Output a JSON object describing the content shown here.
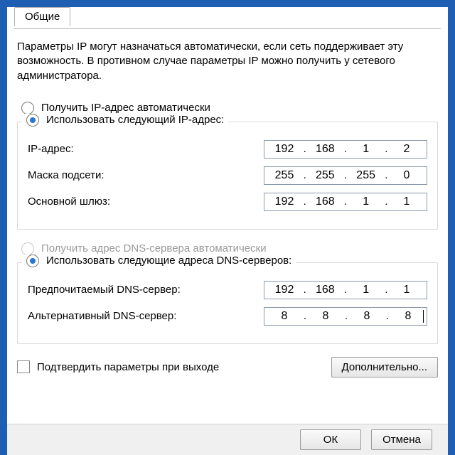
{
  "tab": {
    "label": "Общие"
  },
  "description": "Параметры IP могут назначаться автоматически, если сеть поддерживает эту возможность. В противном случае параметры IP можно получить у сетевого администратора.",
  "ip_section": {
    "auto_label": "Получить IP-адрес автоматически",
    "manual_label": "Использовать следующий IP-адрес:",
    "selected": "manual",
    "fields": {
      "ip": {
        "label": "IP-адрес:",
        "octets": [
          "192",
          "168",
          "1",
          "2"
        ]
      },
      "mask": {
        "label": "Маска подсети:",
        "octets": [
          "255",
          "255",
          "255",
          "0"
        ]
      },
      "gateway": {
        "label": "Основной шлюз:",
        "octets": [
          "192",
          "168",
          "1",
          "1"
        ]
      }
    }
  },
  "dns_section": {
    "auto_label": "Получить адрес DNS-сервера автоматически",
    "auto_enabled": false,
    "manual_label": "Использовать следующие адреса DNS-серверов:",
    "selected": "manual",
    "fields": {
      "preferred": {
        "label": "Предпочитаемый DNS-сервер:",
        "octets": [
          "192",
          "168",
          "1",
          "1"
        ]
      },
      "alternate": {
        "label": "Альтернативный DNS-сервер:",
        "octets": [
          "8",
          "8",
          "8",
          "8"
        ]
      }
    }
  },
  "validate_checkbox": {
    "label": "Подтвердить параметры при выходе",
    "checked": false
  },
  "buttons": {
    "advanced": "Дополнительно...",
    "ok": "ОК",
    "cancel": "Отмена"
  }
}
